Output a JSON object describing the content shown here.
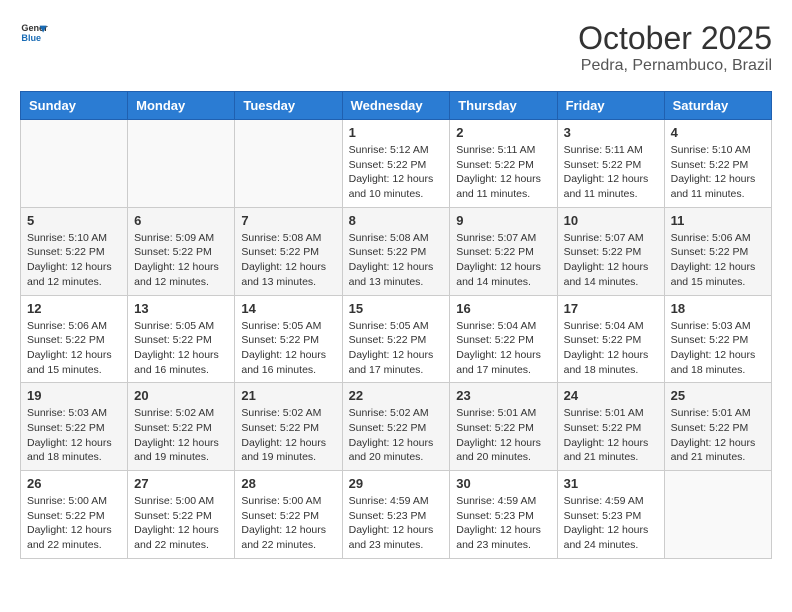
{
  "logo": {
    "line1": "General",
    "line2": "Blue"
  },
  "title": "October 2025",
  "subtitle": "Pedra, Pernambuco, Brazil",
  "days_of_week": [
    "Sunday",
    "Monday",
    "Tuesday",
    "Wednesday",
    "Thursday",
    "Friday",
    "Saturday"
  ],
  "weeks": [
    [
      {
        "day": "",
        "info": ""
      },
      {
        "day": "",
        "info": ""
      },
      {
        "day": "",
        "info": ""
      },
      {
        "day": "1",
        "info": "Sunrise: 5:12 AM\nSunset: 5:22 PM\nDaylight: 12 hours\nand 10 minutes."
      },
      {
        "day": "2",
        "info": "Sunrise: 5:11 AM\nSunset: 5:22 PM\nDaylight: 12 hours\nand 11 minutes."
      },
      {
        "day": "3",
        "info": "Sunrise: 5:11 AM\nSunset: 5:22 PM\nDaylight: 12 hours\nand 11 minutes."
      },
      {
        "day": "4",
        "info": "Sunrise: 5:10 AM\nSunset: 5:22 PM\nDaylight: 12 hours\nand 11 minutes."
      }
    ],
    [
      {
        "day": "5",
        "info": "Sunrise: 5:10 AM\nSunset: 5:22 PM\nDaylight: 12 hours\nand 12 minutes."
      },
      {
        "day": "6",
        "info": "Sunrise: 5:09 AM\nSunset: 5:22 PM\nDaylight: 12 hours\nand 12 minutes."
      },
      {
        "day": "7",
        "info": "Sunrise: 5:08 AM\nSunset: 5:22 PM\nDaylight: 12 hours\nand 13 minutes."
      },
      {
        "day": "8",
        "info": "Sunrise: 5:08 AM\nSunset: 5:22 PM\nDaylight: 12 hours\nand 13 minutes."
      },
      {
        "day": "9",
        "info": "Sunrise: 5:07 AM\nSunset: 5:22 PM\nDaylight: 12 hours\nand 14 minutes."
      },
      {
        "day": "10",
        "info": "Sunrise: 5:07 AM\nSunset: 5:22 PM\nDaylight: 12 hours\nand 14 minutes."
      },
      {
        "day": "11",
        "info": "Sunrise: 5:06 AM\nSunset: 5:22 PM\nDaylight: 12 hours\nand 15 minutes."
      }
    ],
    [
      {
        "day": "12",
        "info": "Sunrise: 5:06 AM\nSunset: 5:22 PM\nDaylight: 12 hours\nand 15 minutes."
      },
      {
        "day": "13",
        "info": "Sunrise: 5:05 AM\nSunset: 5:22 PM\nDaylight: 12 hours\nand 16 minutes."
      },
      {
        "day": "14",
        "info": "Sunrise: 5:05 AM\nSunset: 5:22 PM\nDaylight: 12 hours\nand 16 minutes."
      },
      {
        "day": "15",
        "info": "Sunrise: 5:05 AM\nSunset: 5:22 PM\nDaylight: 12 hours\nand 17 minutes."
      },
      {
        "day": "16",
        "info": "Sunrise: 5:04 AM\nSunset: 5:22 PM\nDaylight: 12 hours\nand 17 minutes."
      },
      {
        "day": "17",
        "info": "Sunrise: 5:04 AM\nSunset: 5:22 PM\nDaylight: 12 hours\nand 18 minutes."
      },
      {
        "day": "18",
        "info": "Sunrise: 5:03 AM\nSunset: 5:22 PM\nDaylight: 12 hours\nand 18 minutes."
      }
    ],
    [
      {
        "day": "19",
        "info": "Sunrise: 5:03 AM\nSunset: 5:22 PM\nDaylight: 12 hours\nand 18 minutes."
      },
      {
        "day": "20",
        "info": "Sunrise: 5:02 AM\nSunset: 5:22 PM\nDaylight: 12 hours\nand 19 minutes."
      },
      {
        "day": "21",
        "info": "Sunrise: 5:02 AM\nSunset: 5:22 PM\nDaylight: 12 hours\nand 19 minutes."
      },
      {
        "day": "22",
        "info": "Sunrise: 5:02 AM\nSunset: 5:22 PM\nDaylight: 12 hours\nand 20 minutes."
      },
      {
        "day": "23",
        "info": "Sunrise: 5:01 AM\nSunset: 5:22 PM\nDaylight: 12 hours\nand 20 minutes."
      },
      {
        "day": "24",
        "info": "Sunrise: 5:01 AM\nSunset: 5:22 PM\nDaylight: 12 hours\nand 21 minutes."
      },
      {
        "day": "25",
        "info": "Sunrise: 5:01 AM\nSunset: 5:22 PM\nDaylight: 12 hours\nand 21 minutes."
      }
    ],
    [
      {
        "day": "26",
        "info": "Sunrise: 5:00 AM\nSunset: 5:22 PM\nDaylight: 12 hours\nand 22 minutes."
      },
      {
        "day": "27",
        "info": "Sunrise: 5:00 AM\nSunset: 5:22 PM\nDaylight: 12 hours\nand 22 minutes."
      },
      {
        "day": "28",
        "info": "Sunrise: 5:00 AM\nSunset: 5:22 PM\nDaylight: 12 hours\nand 22 minutes."
      },
      {
        "day": "29",
        "info": "Sunrise: 4:59 AM\nSunset: 5:23 PM\nDaylight: 12 hours\nand 23 minutes."
      },
      {
        "day": "30",
        "info": "Sunrise: 4:59 AM\nSunset: 5:23 PM\nDaylight: 12 hours\nand 23 minutes."
      },
      {
        "day": "31",
        "info": "Sunrise: 4:59 AM\nSunset: 5:23 PM\nDaylight: 12 hours\nand 24 minutes."
      },
      {
        "day": "",
        "info": ""
      }
    ]
  ]
}
